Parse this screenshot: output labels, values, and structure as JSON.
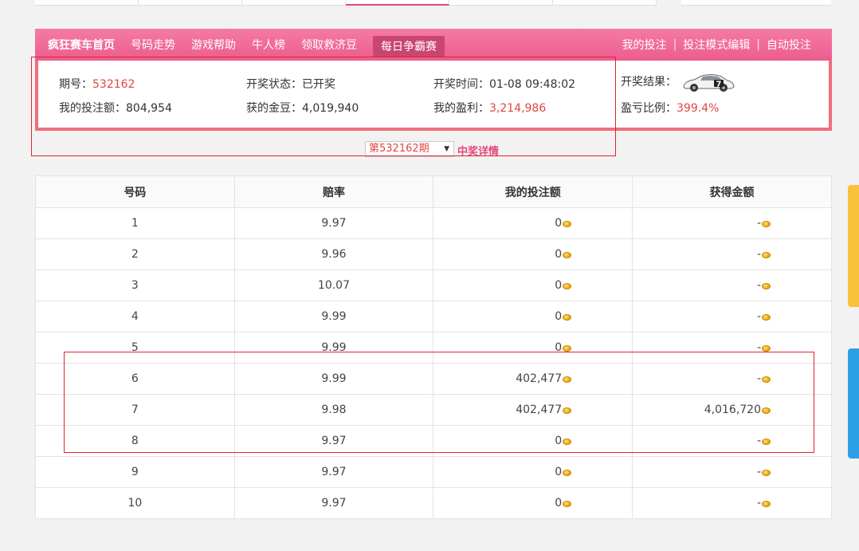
{
  "nav": {
    "left": [
      "疯狂赛车首页",
      "号码走势",
      "游戏帮助",
      "牛人榜",
      "领取救济豆",
      "每日争霸赛"
    ],
    "right": [
      "我的投注",
      "投注模式编辑",
      "自动投注"
    ],
    "separator": "|"
  },
  "info": {
    "period_label": "期号：",
    "period_value": "532162",
    "status_label": "开奖状态：",
    "status_value": "已开奖",
    "time_label": "开奖时间：",
    "time_value": "01-08 09:48:02",
    "result_label": "开奖结果：",
    "result_number": "7",
    "bet_label": "我的投注额：",
    "bet_value": "804,954",
    "gold_label": "获的金豆：",
    "gold_value": "4,019,940",
    "profit_label": "我的盈利：",
    "profit_value": "3,214,986",
    "ratio_label": "盈亏比例：",
    "ratio_value": "399.4%"
  },
  "period_select": {
    "value": "第532162期",
    "arrow": "▼"
  },
  "win_detail_label": "中奖详情",
  "table": {
    "headers": [
      "号码",
      "赔率",
      "我的投注额",
      "获得金额"
    ],
    "rows": [
      {
        "num": "1",
        "odds": "9.97",
        "bet": "0",
        "win": "-"
      },
      {
        "num": "2",
        "odds": "9.96",
        "bet": "0",
        "win": "-"
      },
      {
        "num": "3",
        "odds": "10.07",
        "bet": "0",
        "win": "-"
      },
      {
        "num": "4",
        "odds": "9.99",
        "bet": "0",
        "win": "-"
      },
      {
        "num": "5",
        "odds": "9.99",
        "bet": "0",
        "win": "-"
      },
      {
        "num": "6",
        "odds": "9.99",
        "bet": "402,477",
        "win": "-"
      },
      {
        "num": "7",
        "odds": "9.98",
        "bet": "402,477",
        "win": "4,016,720"
      },
      {
        "num": "8",
        "odds": "9.97",
        "bet": "0",
        "win": "-"
      },
      {
        "num": "9",
        "odds": "9.97",
        "bet": "0",
        "win": "-"
      },
      {
        "num": "10",
        "odds": "9.97",
        "bet": "0",
        "win": "-"
      }
    ]
  },
  "colors": {
    "accent": "#ec5d8e",
    "highlight": "#e0463f",
    "annotation": "#e0242e"
  },
  "icons": {
    "coin": "gold-coin-icon",
    "car": "race-car-icon"
  }
}
